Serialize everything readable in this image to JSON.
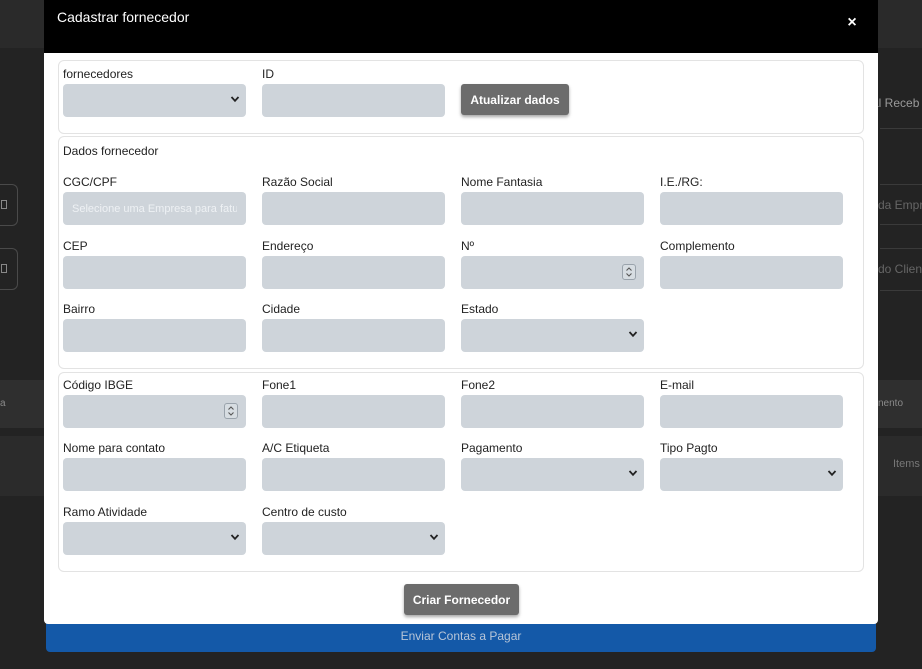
{
  "background": {
    "right_header_text": "al Receb",
    "right_input1_text": "da Empr",
    "right_input2_text": "do Client",
    "row_left_text": "a",
    "row_right_text": "nento",
    "items_text": "Items",
    "bottom_bar_label": "Enviar Contas a Pagar"
  },
  "modal": {
    "title": "Cadastrar fornecedor",
    "close_label": "×",
    "top_card": {
      "fornecedores_label": "fornecedores",
      "id_label": "ID",
      "id_value": "",
      "update_button": "Atualizar dados"
    },
    "dados": {
      "section_title": "Dados fornecedor",
      "cgc_label": "CGC/CPF",
      "cgc_placeholder": "Selecione uma Empresa para fatu",
      "razao_label": "Razão Social",
      "fantasia_label": "Nome Fantasia",
      "ie_label": "I.E./RG:",
      "cep_label": "CEP",
      "endereco_label": "Endereço",
      "numero_label": "Nº",
      "complemento_label": "Complemento",
      "bairro_label": "Bairro",
      "cidade_label": "Cidade",
      "estado_label": "Estado"
    },
    "contato": {
      "ibge_label": "Código IBGE",
      "fone1_label": "Fone1",
      "fone2_label": "Fone2",
      "email_label": "E-mail",
      "nome_contato_label": "Nome para contato",
      "etiqueta_label": "A/C Etiqueta",
      "pagamento_label": "Pagamento",
      "tipo_pagto_label": "Tipo Pagto",
      "ramo_label": "Ramo Atividade",
      "centro_custo_label": "Centro de custo"
    },
    "create_button": "Criar Fornecedor"
  },
  "colors": {
    "modal_header": "#000000",
    "input_fill": "#ced4da",
    "button_grey": "#6c6c6c",
    "bottom_bar": "#1459a8"
  }
}
